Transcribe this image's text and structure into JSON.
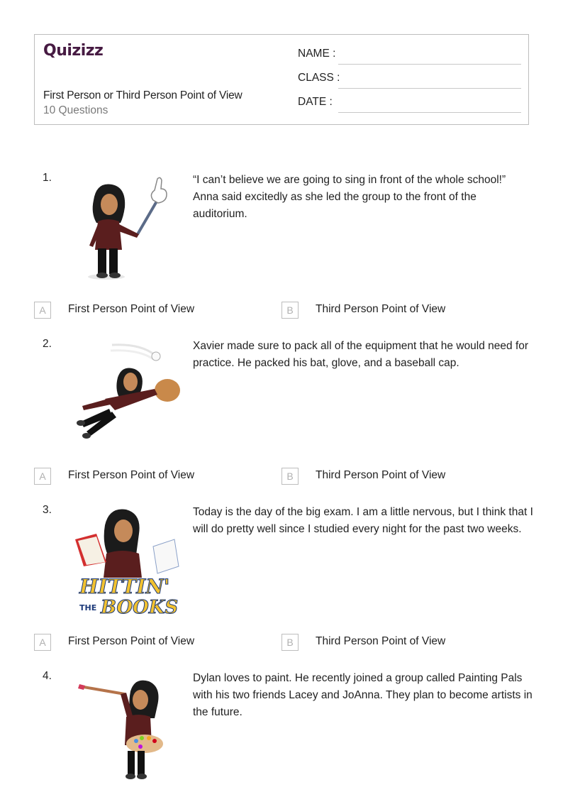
{
  "header": {
    "logo": "Quizizz",
    "title": "First Person or Third Person Point of View",
    "question_count": "10 Questions",
    "fields": [
      {
        "label": "NAME :"
      },
      {
        "label": "CLASS :"
      },
      {
        "label": "DATE  :"
      }
    ]
  },
  "colors": {
    "logo": "#461a42",
    "border": "#bdbdbd",
    "muted_text": "#7a7a7a"
  },
  "questions": [
    {
      "number": "1.",
      "image": "bitmoji-pointing-foam-finger",
      "text": "“I can’t believe we are going to sing in front of the whole school!” Anna said excitedly as she led the group to the front of the auditorium.",
      "options": [
        {
          "letter": "A",
          "text": "First Person Point of View"
        },
        {
          "letter": "B",
          "text": "Third Person Point of View"
        }
      ]
    },
    {
      "number": "2.",
      "image": "bitmoji-catching-baseball",
      "text": "Xavier made sure to pack all of the equipment that he would need for practice. He packed his bat, glove, and a baseball cap.",
      "options": [
        {
          "letter": "A",
          "text": "First Person Point of View"
        },
        {
          "letter": "B",
          "text": "Third Person Point of View"
        }
      ]
    },
    {
      "number": "3.",
      "image": "bitmoji-hittin-the-books",
      "image_caption_1": "HITTIN'",
      "image_caption_2": "THE",
      "image_caption_3": "BOOKS",
      "text": "Today is the day of the big exam. I am a little nervous, but I think that I will do pretty well since I studied every night for the past two weeks.",
      "options": [
        {
          "letter": "A",
          "text": "First Person Point of View"
        },
        {
          "letter": "B",
          "text": "Third Person Point of View"
        }
      ]
    },
    {
      "number": "4.",
      "image": "bitmoji-painting",
      "text": "Dylan loves to paint. He recently joined a group called Painting Pals with his two friends Lacey and JoAnna. They plan to become artists in the future."
    }
  ]
}
